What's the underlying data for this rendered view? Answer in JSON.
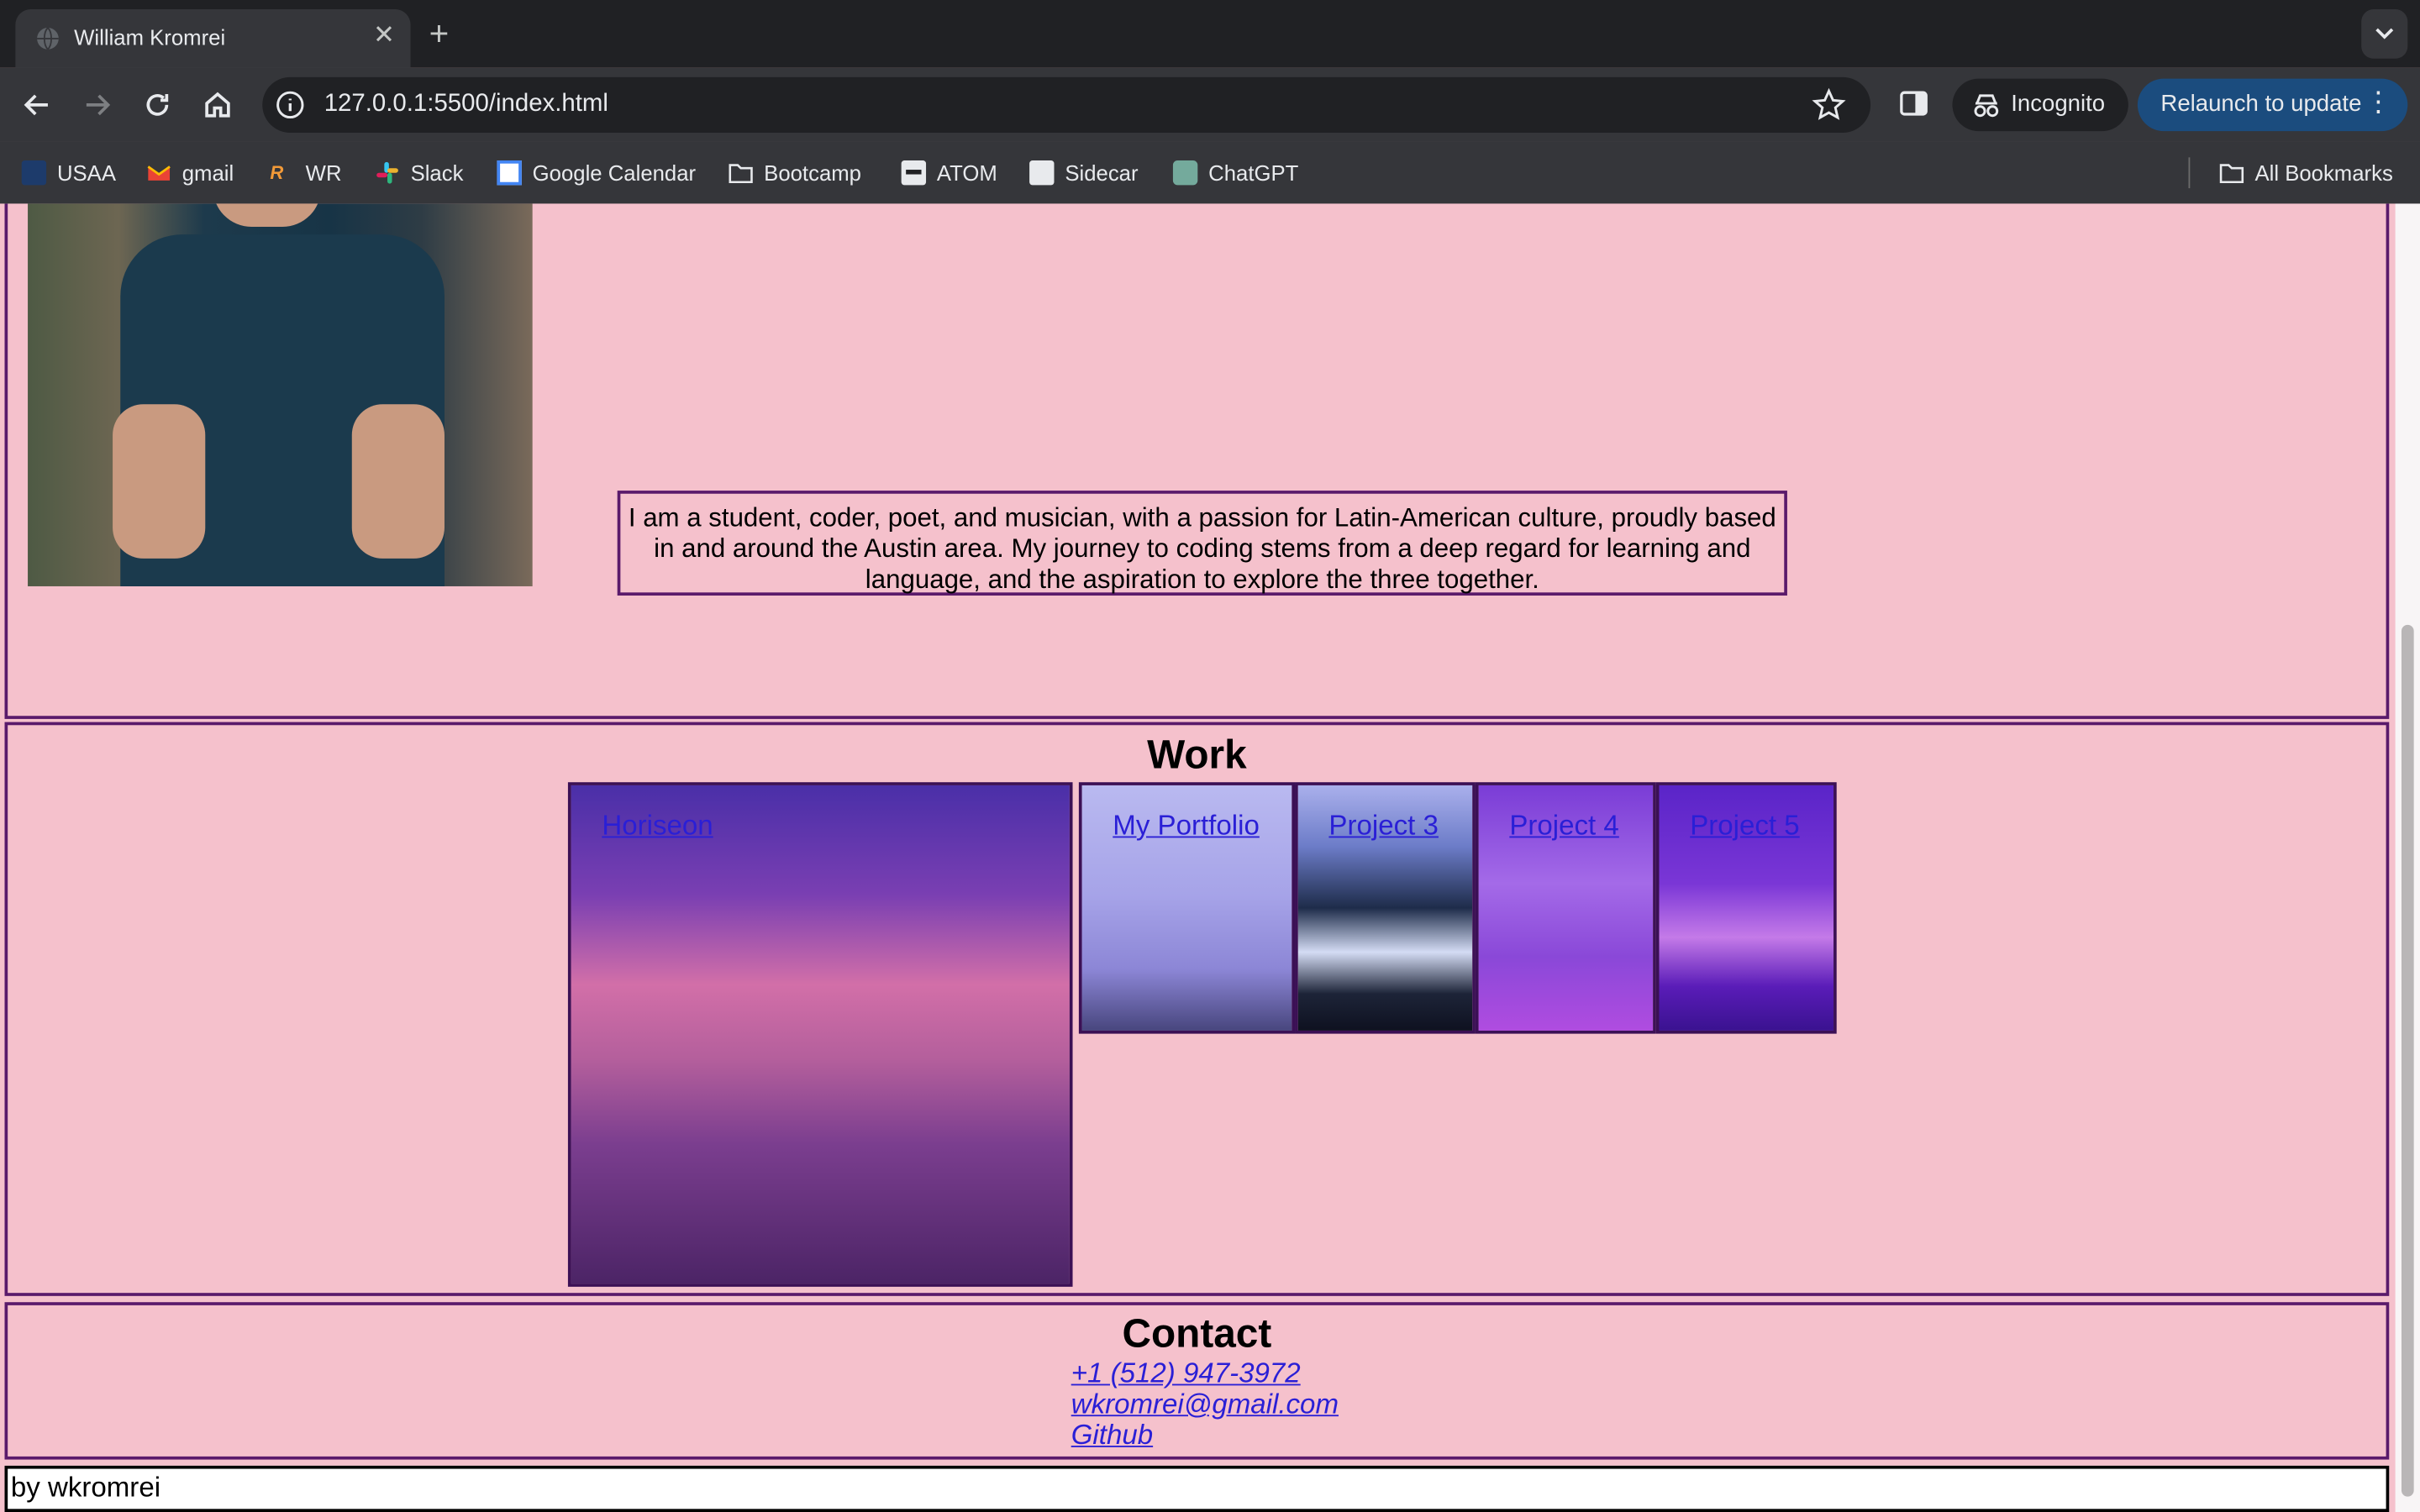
{
  "browser": {
    "tab_title": "William Kromrei",
    "url": "127.0.0.1:5500/index.html",
    "incognito_label": "Incognito",
    "relaunch_label": "Relaunch to update",
    "bookmarks": [
      {
        "label": "USAA",
        "icon": "usaa-icon"
      },
      {
        "label": "gmail",
        "icon": "gmail-icon"
      },
      {
        "label": "WR",
        "icon": "wr-icon"
      },
      {
        "label": "Slack",
        "icon": "slack-icon"
      },
      {
        "label": "Google Calendar",
        "icon": "calendar-icon"
      },
      {
        "label": "Bootcamp",
        "icon": "folder-icon"
      },
      {
        "label": "ATOM",
        "icon": "atom-icon"
      },
      {
        "label": "Sidecar",
        "icon": "sidecar-icon"
      },
      {
        "label": "ChatGPT",
        "icon": "chatgpt-icon"
      }
    ],
    "all_bookmarks_label": "All Bookmarks"
  },
  "about": {
    "bio": "I am a student, coder, poet, and musician, with a passion for Latin-American culture, proudly based in and around the Austin area. My journey to coding stems from a deep regard for learning and language, and the aspiration to explore the three together."
  },
  "work": {
    "heading": "Work",
    "projects": [
      {
        "label": "Horiseon"
      },
      {
        "label": "My Portfolio"
      },
      {
        "label": "Project 3"
      },
      {
        "label": "Project 4"
      },
      {
        "label": "Project 5"
      }
    ]
  },
  "contact": {
    "heading": "Contact",
    "phone": "+1 (512) 947-3972",
    "email": "wkromrei@gmail.com",
    "github": "Github"
  },
  "footer": {
    "text": "by wkromrei"
  },
  "colors": {
    "page_bg": "#f5c1cc",
    "border": "#5a1a6b",
    "link": "#2a1fd6"
  }
}
